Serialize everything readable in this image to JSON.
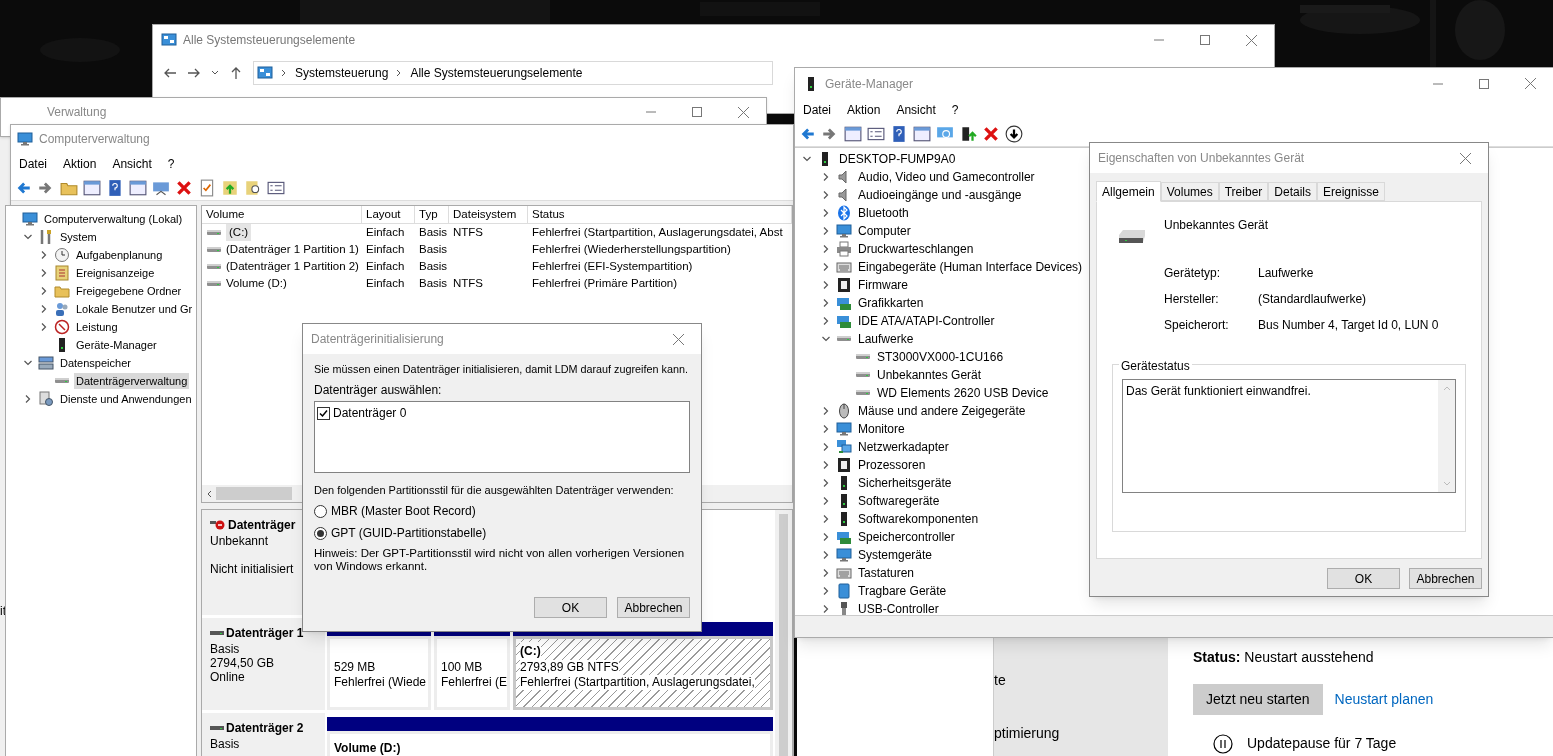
{
  "control_panel": {
    "title": "Alle Systemsteuerungselemente",
    "breadcrumb": [
      "Systemsteuerung",
      "Alle Systemsteuerungselemente"
    ]
  },
  "background_window": {
    "fragment": "it"
  },
  "admin_window": {
    "title": "Verwaltung"
  },
  "computer_management": {
    "title": "Computerverwaltung",
    "menu": [
      "Datei",
      "Aktion",
      "Ansicht",
      "?"
    ],
    "tree": [
      {
        "label": "Computerverwaltung (Lokal)",
        "selected": false,
        "children": [
          {
            "label": "System",
            "expanded": true,
            "selected": false,
            "children": [
              {
                "label": "Aufgabenplanung",
                "expanded": false,
                "selected": false
              },
              {
                "label": "Ereignisanzeige",
                "expanded": false,
                "selected": false
              },
              {
                "label": "Freigegebene Ordner",
                "expanded": false,
                "selected": false
              },
              {
                "label": "Lokale Benutzer und Gr",
                "expanded": false,
                "selected": false
              },
              {
                "label": "Leistung",
                "expanded": false,
                "selected": false
              },
              {
                "label": "Geräte-Manager",
                "selected": false
              }
            ]
          },
          {
            "label": "Datenspeicher",
            "expanded": true,
            "selected": false,
            "children": [
              {
                "label": "Datenträgerverwaltung",
                "selected": true
              }
            ]
          },
          {
            "label": "Dienste und Anwendungen",
            "expanded": false,
            "selected": false
          }
        ]
      }
    ],
    "volumes": {
      "columns": [
        "Volume",
        "Layout",
        "Typ",
        "Dateisystem",
        "Status"
      ],
      "rows": [
        {
          "cells": [
            "(C:)",
            "Einfach",
            "Basis",
            "NTFS",
            "Fehlerfrei (Startpartition, Auslagerungsdatei, Abst"
          ],
          "selected": true
        },
        {
          "cells": [
            "(Datenträger 1 Partition 1)",
            "Einfach",
            "Basis",
            "",
            "Fehlerfrei (Wiederherstellungspartition)"
          ],
          "selected": false
        },
        {
          "cells": [
            "(Datenträger 1 Partition 2)",
            "Einfach",
            "Basis",
            "",
            "Fehlerfrei (EFI-Systempartition)"
          ],
          "selected": false
        },
        {
          "cells": [
            "Volume (D:)",
            "Einfach",
            "Basis",
            "NTFS",
            "Fehlerfrei (Primäre Partition)"
          ],
          "selected": false
        }
      ]
    },
    "disks": [
      {
        "name": "Datenträger",
        "kind": "unknown",
        "lines": [
          "Unbekannt",
          "Nicht initialisiert"
        ]
      },
      {
        "name": "Datenträger 1",
        "kind": "basic",
        "lines": [
          "Basis",
          "2794,50 GB",
          "Online"
        ],
        "partitions": [
          {
            "lines": [
              "529 MB",
              "Fehlerfrei (Wiede"
            ],
            "selected": false
          },
          {
            "lines": [
              "100 MB",
              "Fehlerfrei (E"
            ],
            "selected": false
          },
          {
            "title": "(C:)",
            "lines": [
              "2793,89 GB NTFS",
              "Fehlerfrei (Startpartition, Auslagerungsdatei,"
            ],
            "selected": true
          }
        ]
      },
      {
        "name": "Datenträger 2",
        "kind": "basic",
        "lines": [
          "Basis"
        ],
        "partitions": [
          {
            "title": "Volume (D:)",
            "selected": false
          }
        ]
      }
    ]
  },
  "init_dialog": {
    "title": "Datenträgerinitialisierung",
    "intro": "Sie müssen einen Datenträger initialisieren, damit LDM darauf zugreifen kann.",
    "list_label": "Datenträger auswählen:",
    "disks": [
      {
        "label": "Datenträger 0",
        "checked": true
      }
    ],
    "style_label": "Den folgenden Partitionsstil für die ausgewählten Datenträger verwenden:",
    "styles": [
      {
        "label": "MBR (Master Boot Record)",
        "selected": false
      },
      {
        "label": "GPT (GUID-Partitionstabelle)",
        "selected": true
      }
    ],
    "note": "Hinweis: Der GPT-Partitionsstil wird nicht von allen vorherigen Versionen von Windows erkannt.",
    "buttons": [
      "OK",
      "Abbrechen"
    ]
  },
  "device_manager": {
    "title": "Geräte-Manager",
    "menu": [
      "Datei",
      "Aktion",
      "Ansicht",
      "?"
    ],
    "tree": [
      {
        "label": "DESKTOP-FUMP9A0",
        "expanded": true,
        "selected": false,
        "children": [
          {
            "label": "Audio, Video und Gamecontroller",
            "expanded": false,
            "selected": false
          },
          {
            "label": "Audioeingänge und -ausgänge",
            "expanded": false,
            "selected": false
          },
          {
            "label": "Bluetooth",
            "expanded": false,
            "selected": false
          },
          {
            "label": "Computer",
            "expanded": false,
            "selected": false
          },
          {
            "label": "Druckwarteschlangen",
            "expanded": false,
            "selected": false
          },
          {
            "label": "Eingabegeräte (Human Interface Devices)",
            "expanded": false,
            "selected": false
          },
          {
            "label": "Firmware",
            "expanded": false,
            "selected": false
          },
          {
            "label": "Grafikkarten",
            "expanded": false,
            "selected": false
          },
          {
            "label": "IDE ATA/ATAPI-Controller",
            "expanded": false,
            "selected": false
          },
          {
            "label": "Laufwerke",
            "expanded": true,
            "selected": false,
            "children": [
              {
                "label": "ST3000VX000-1CU166",
                "selected": false
              },
              {
                "label": "Unbekanntes Gerät",
                "selected": false
              },
              {
                "label": "WD Elements 2620 USB Device",
                "selected": false
              }
            ]
          },
          {
            "label": "Mäuse und andere Zeigegeräte",
            "expanded": false,
            "selected": false
          },
          {
            "label": "Monitore",
            "expanded": false,
            "selected": false
          },
          {
            "label": "Netzwerkadapter",
            "expanded": false,
            "selected": false
          },
          {
            "label": "Prozessoren",
            "expanded": false,
            "selected": false
          },
          {
            "label": "Sicherheitsgeräte",
            "expanded": false,
            "selected": false
          },
          {
            "label": "Softwaregeräte",
            "expanded": false,
            "selected": false
          },
          {
            "label": "Softwarekomponenten",
            "expanded": false,
            "selected": false
          },
          {
            "label": "Speichercontroller",
            "expanded": false,
            "selected": false
          },
          {
            "label": "Systemgeräte",
            "expanded": false,
            "selected": false
          },
          {
            "label": "Tastaturen",
            "expanded": false,
            "selected": false
          },
          {
            "label": "Tragbare Geräte",
            "expanded": false,
            "selected": false
          },
          {
            "label": "USB-Controller",
            "expanded": false,
            "selected": false
          }
        ]
      }
    ]
  },
  "properties": {
    "title": "Eigenschaften von Unbekanntes Gerät",
    "tabs": [
      {
        "label": "Allgemein",
        "selected": true
      },
      {
        "label": "Volumes",
        "selected": false
      },
      {
        "label": "Treiber",
        "selected": false
      },
      {
        "label": "Details",
        "selected": false
      },
      {
        "label": "Ereignisse",
        "selected": false
      }
    ],
    "device_name": "Unbekanntes Gerät",
    "fields": [
      {
        "label": "Gerätetyp:",
        "value": "Laufwerke"
      },
      {
        "label": "Hersteller:",
        "value": "(Standardlaufwerke)"
      },
      {
        "label": "Speicherort:",
        "value": "Bus Number 4, Target Id 0, LUN 0"
      }
    ],
    "status_group": "Gerätestatus",
    "status_text": "Das Gerät funktioniert einwandfrei.",
    "buttons": [
      "OK",
      "Abbrechen"
    ]
  },
  "settings": {
    "sidebar_fragments": [
      "te",
      "ptimierung"
    ],
    "status": "**Status:** Neustart ausstehend",
    "restart_button": "Jetzt neu starten",
    "schedule_link": "Neustart planen",
    "pause_label": "Updatepause für 7 Tage"
  }
}
